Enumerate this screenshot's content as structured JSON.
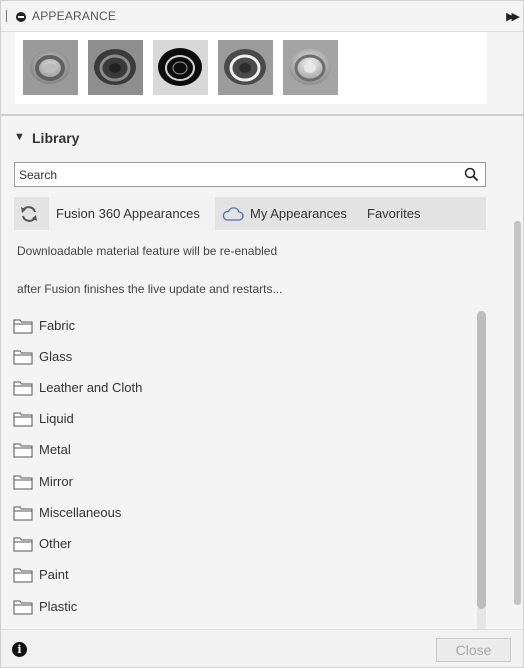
{
  "header": {
    "title": "APPEARANCE",
    "collapse_icon": "minus-circle-icon",
    "expand_icon": "double-chevron-right-icon"
  },
  "swatches": [
    {
      "name": "swatch-1",
      "color": "#8a8a8a"
    },
    {
      "name": "swatch-2",
      "color": "#4a4a4a"
    },
    {
      "name": "swatch-3",
      "color": "#1a1a1a"
    },
    {
      "name": "swatch-4",
      "color": "#555555"
    },
    {
      "name": "swatch-5",
      "color": "#b8b8b8"
    }
  ],
  "library": {
    "title": "Library",
    "search_placeholder": "Search",
    "tabs": {
      "active": "Fusion 360 Appearances",
      "my": "My Appearances",
      "favorites": "Favorites"
    },
    "notice_line1": "Downloadable material feature will be re-enabled",
    "notice_line2": "after Fusion finishes the live update and restarts...",
    "folders": [
      "Fabric",
      "Glass",
      "Leather and Cloth",
      "Liquid",
      "Metal",
      "Mirror",
      "Miscellaneous",
      "Other",
      "Paint",
      "Plastic"
    ]
  },
  "footer": {
    "close_label": "Close"
  },
  "colors": {
    "panel_bg": "#f4f4f4",
    "tab_bar_bg": "#e3e3e3",
    "cloud_accent": "#4a6fb3"
  }
}
